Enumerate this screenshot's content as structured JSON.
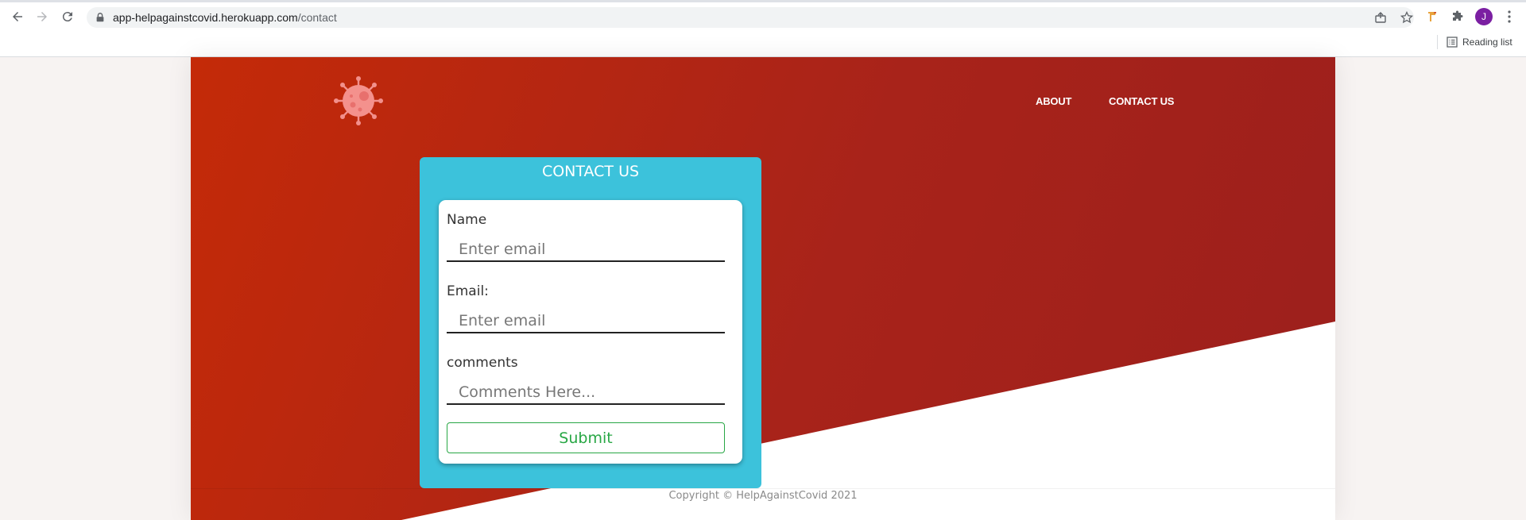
{
  "browser": {
    "url_host": "app-helpagainstcovid.herokuapp.com",
    "url_path": "/contact",
    "profile_initial": "J",
    "reading_list_label": "Reading list",
    "icons": [
      "back-arrow-icon",
      "forward-arrow-icon",
      "reload-icon",
      "lock-icon",
      "share-icon",
      "bookmark-star-icon",
      "extension-flag-icon",
      "puzzle-icon",
      "kebab-menu-icon",
      "reading-list-icon"
    ]
  },
  "header": {
    "logo_icon": "virus-icon",
    "nav": [
      {
        "label": "ABOUT"
      },
      {
        "label": "CONTACT US"
      }
    ]
  },
  "contact_card": {
    "title": "CONTACT US",
    "fields": [
      {
        "label": "Name",
        "placeholder": "Enter email",
        "value": ""
      },
      {
        "label": "Email:",
        "placeholder": "Enter email",
        "value": ""
      },
      {
        "label": "comments",
        "placeholder": "Comments Here...",
        "value": ""
      }
    ],
    "submit_label": "Submit"
  },
  "footer": {
    "copyright": "Copyright © HelpAgainstCovid 2021"
  },
  "colors": {
    "hero_red": "#b42611",
    "card_cyan": "#3cc2db",
    "submit_green": "#28a745",
    "avatar_purple": "#7b1fa2"
  }
}
